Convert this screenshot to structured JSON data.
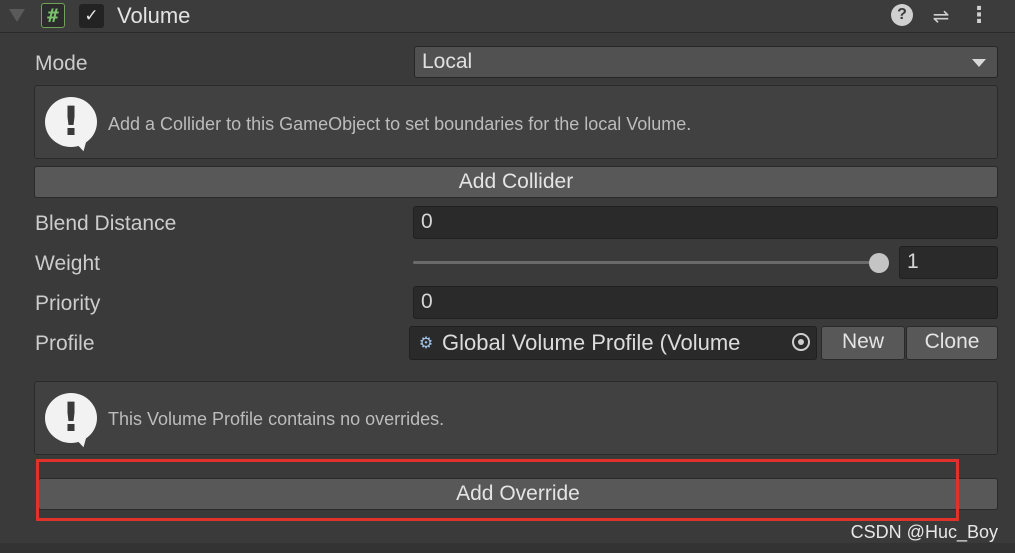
{
  "header": {
    "script_icon": "#",
    "enabled_check": "✓",
    "title": "Volume",
    "help_icon": "?",
    "presets_icon": "⇌",
    "menu_icon": "⋮"
  },
  "mode": {
    "label": "Mode",
    "value": "Local"
  },
  "collider_warning": {
    "icon": "!",
    "text": "Add a Collider to this GameObject to set boundaries for the local Volume."
  },
  "add_collider": {
    "label": "Add Collider"
  },
  "blend_distance": {
    "label": "Blend Distance",
    "value": "0"
  },
  "weight": {
    "label": "Weight",
    "value": "1",
    "fraction": 1.0
  },
  "priority": {
    "label": "Priority",
    "value": "0"
  },
  "profile": {
    "label": "Profile",
    "value": "Global Volume Profile (Volume",
    "new_label": "New",
    "clone_label": "Clone",
    "icon": "⚙"
  },
  "overrides_info": {
    "icon": "!",
    "text": "This Volume Profile contains no overrides."
  },
  "add_override": {
    "label": "Add Override"
  },
  "watermark": "CSDN @Huc_Boy"
}
